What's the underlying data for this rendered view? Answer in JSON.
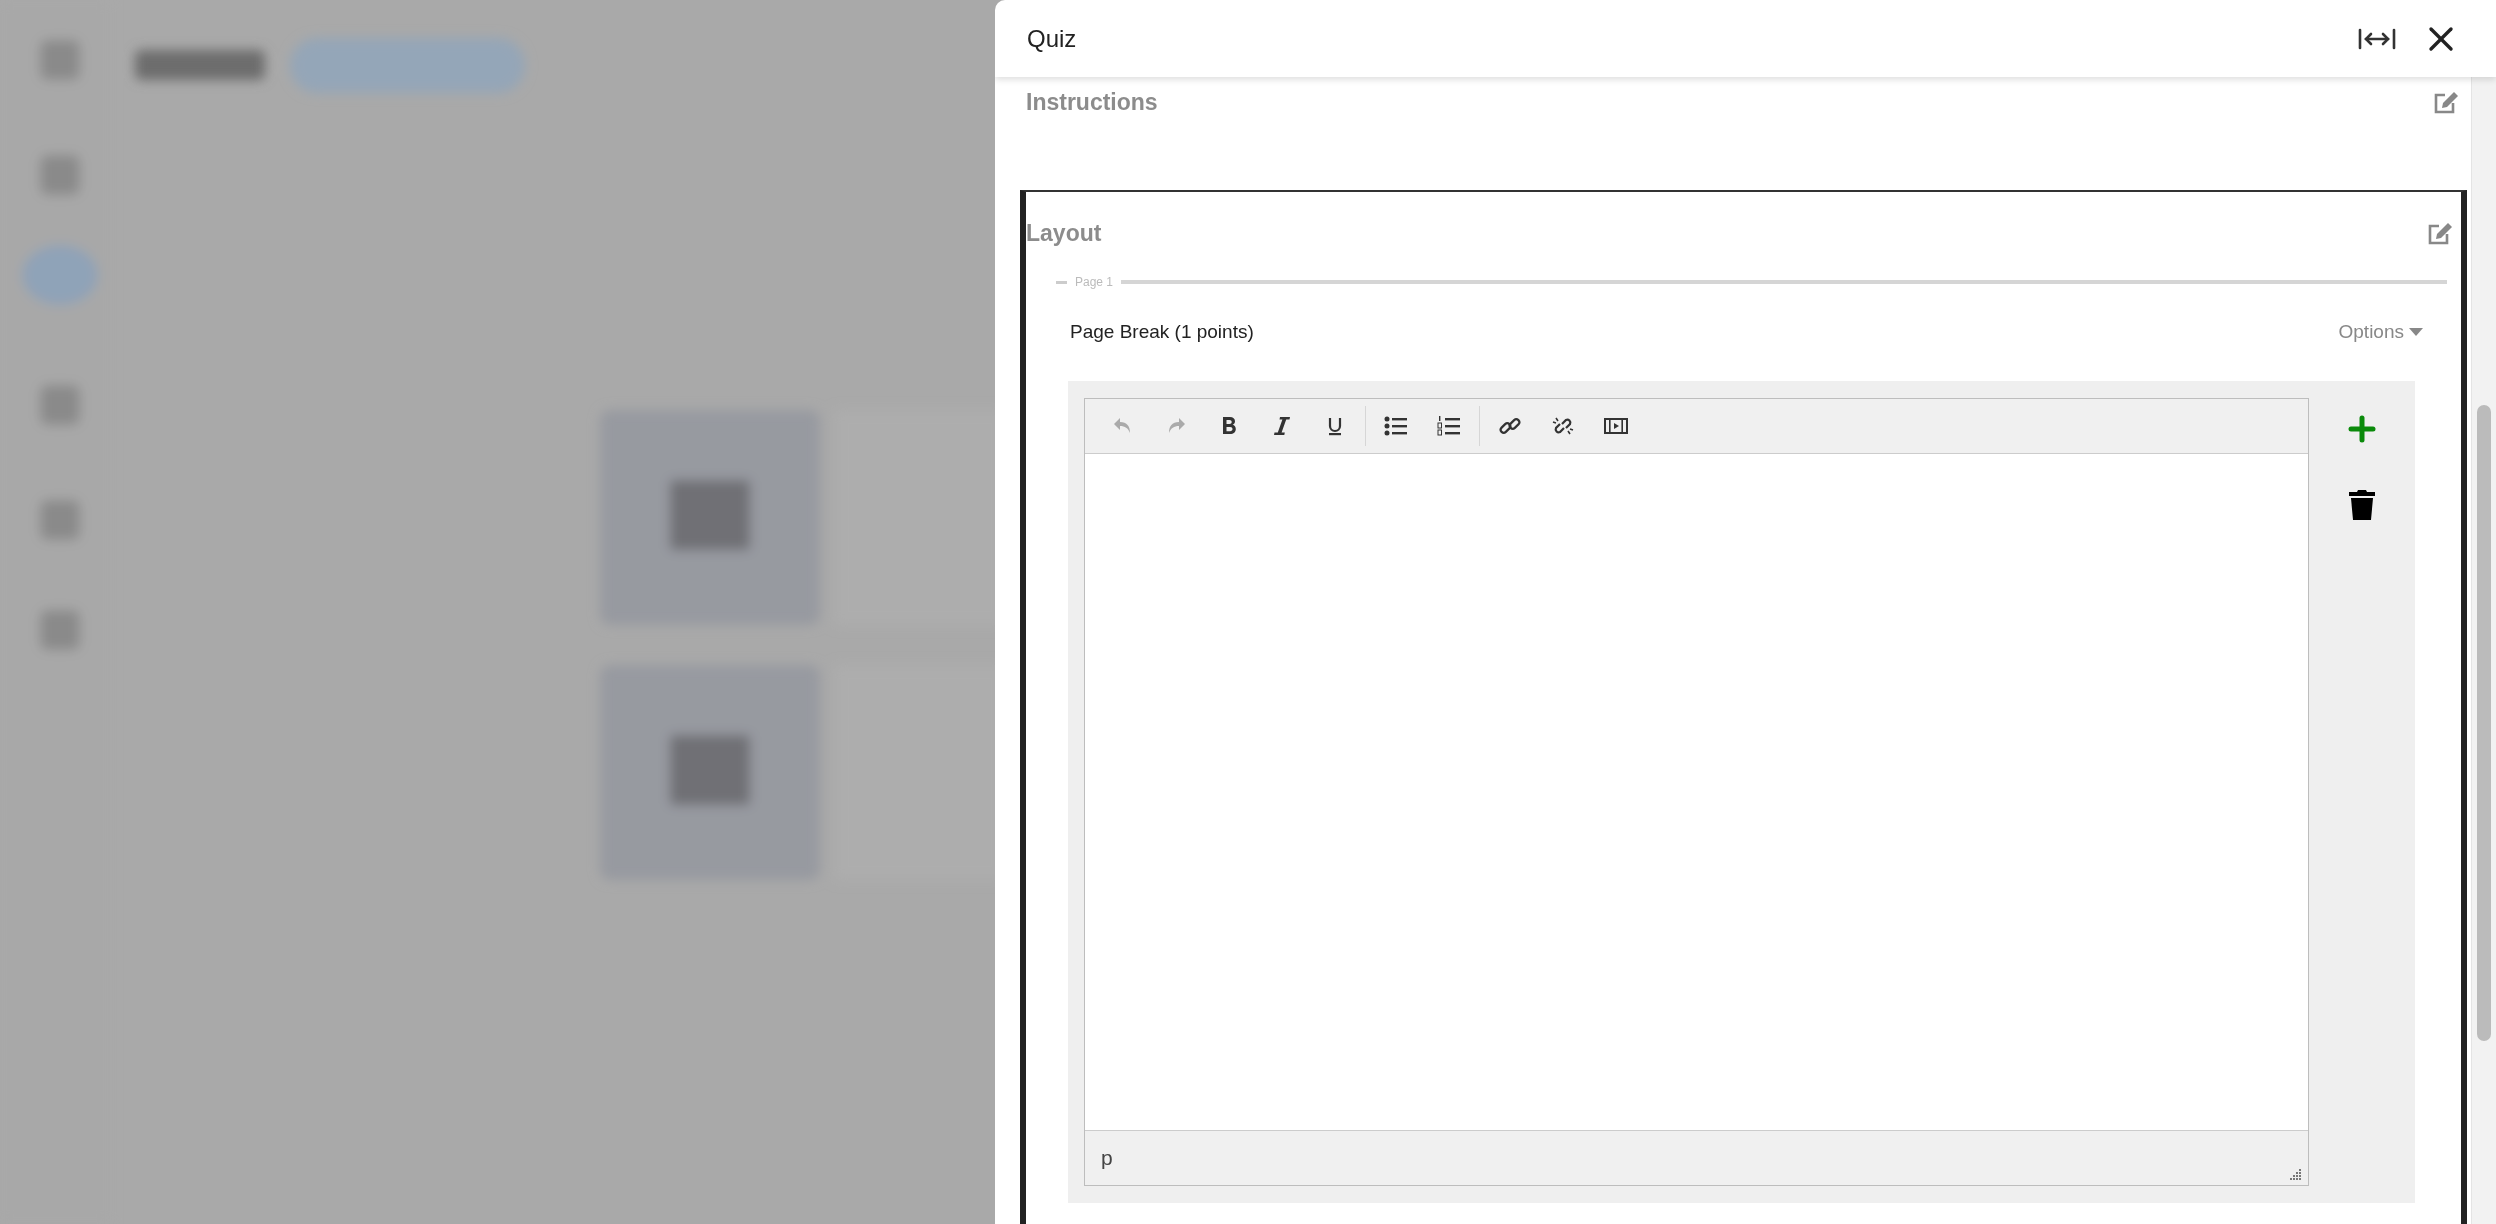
{
  "window": {
    "title": "Quiz"
  },
  "sections": [
    {
      "kind": "instructions",
      "heading": "Instructions"
    },
    {
      "kind": "layout",
      "heading": "Layout",
      "page_label": "Page 1",
      "question": {
        "title": "Page Break (1 points)",
        "options_label": "Options"
      }
    }
  ],
  "editor": {
    "toolbar": [
      [
        {
          "kind": "undo",
          "disabled": true
        },
        {
          "kind": "redo",
          "disabled": true
        },
        {
          "kind": "bold",
          "disabled": false
        },
        {
          "kind": "italic",
          "disabled": false
        },
        {
          "kind": "underline",
          "disabled": false
        }
      ],
      [
        {
          "kind": "bullet-list",
          "disabled": false
        },
        {
          "kind": "numbered-list",
          "disabled": false
        }
      ],
      [
        {
          "kind": "link",
          "disabled": false
        },
        {
          "kind": "unlink",
          "disabled": false
        },
        {
          "kind": "media",
          "disabled": false
        }
      ]
    ],
    "status_path": "p"
  }
}
